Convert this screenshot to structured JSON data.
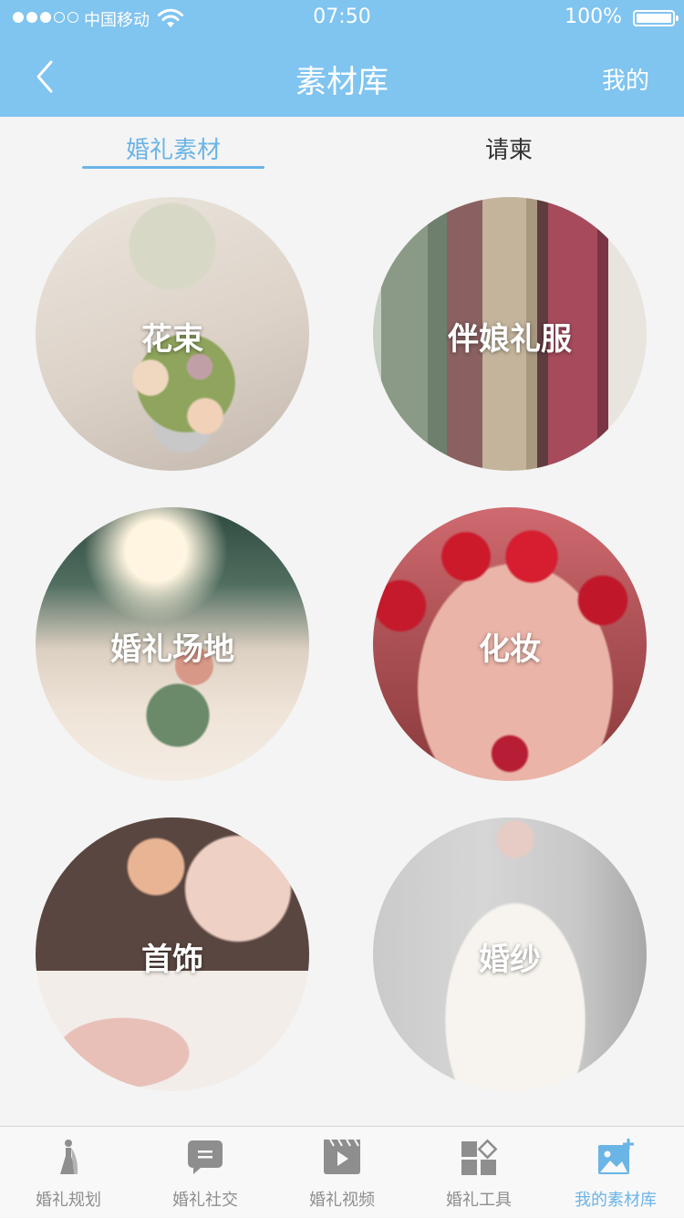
{
  "status_bar": {
    "carrier": "中国移动",
    "time": "07:50",
    "battery": "100%",
    "battery_level": 1.0
  },
  "nav": {
    "title": "素材库",
    "right_label": "我的"
  },
  "tabs": [
    {
      "label": "婚礼素材",
      "active": true
    },
    {
      "label": "请柬",
      "active": false
    }
  ],
  "categories": [
    {
      "label": "花束"
    },
    {
      "label": "伴娘礼服"
    },
    {
      "label": "婚礼场地"
    },
    {
      "label": "化妆"
    },
    {
      "label": "首饰"
    },
    {
      "label": "婚纱"
    }
  ],
  "tabbar": {
    "items": [
      {
        "label": "婚礼规划",
        "icon": "bride-icon"
      },
      {
        "label": "婚礼社交",
        "icon": "chat-bubble-icon"
      },
      {
        "label": "婚礼视频",
        "icon": "video-play-icon"
      },
      {
        "label": "婚礼工具",
        "icon": "tools-grid-icon"
      },
      {
        "label": "我的素材库",
        "icon": "image-add-icon",
        "active": true
      }
    ],
    "active_color": "#6ab4e6",
    "inactive_color": "#8e8e8e"
  },
  "colors": {
    "header_bg": "#80c4f0",
    "accent": "#6ab4e6",
    "page_bg": "#f4f4f4"
  }
}
